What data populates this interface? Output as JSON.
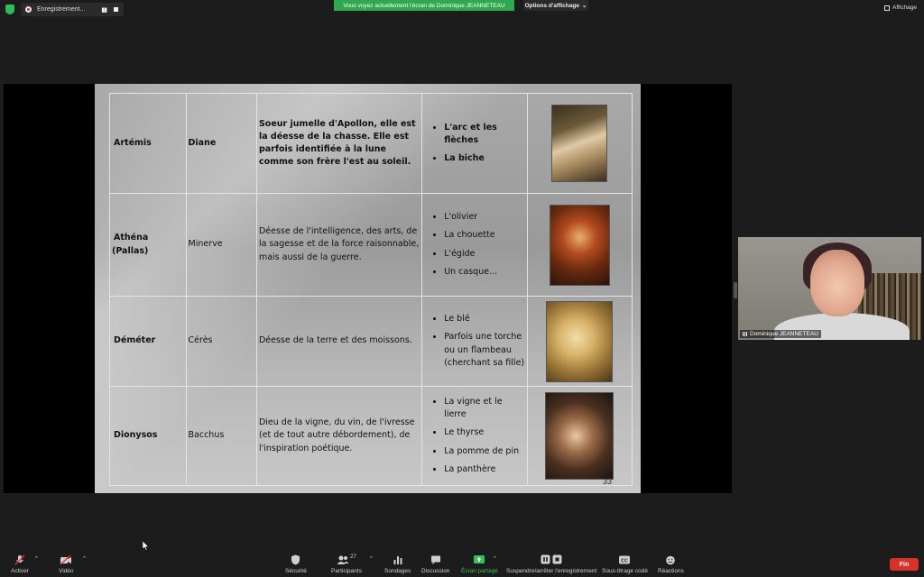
{
  "topbar": {
    "recording_label": "Enregistrement...",
    "share_banner": "Vous voyez actuellement l'écran de Dominique JEANNETEAU",
    "view_options": "Options d'affichage",
    "view_button": "Affichage"
  },
  "slide": {
    "rows": [
      {
        "greek": "Artémis",
        "roman": "Diane",
        "description": "Soeur jumelle d'Apollon, elle est la déesse de la chasse. Elle est parfois identifiée à la lune comme son frère l'est au soleil.",
        "attributes": [
          "L'arc et les flèches",
          "La biche"
        ]
      },
      {
        "greek": "Athéna (Pallas)",
        "roman": "Minerve",
        "description": "Déesse de l'intelligence, des arts, de la sagesse et de la force raisonnable, mais aussi de la guerre.",
        "attributes": [
          "L'olivier",
          "La chouette",
          "L'égide",
          "Un casque..."
        ]
      },
      {
        "greek": "Déméter",
        "roman": "Cérès",
        "description": "Déesse de la terre et des moissons.",
        "attributes": [
          "Le blé",
          "Parfois une torche ou un flambeau (cherchant sa fille)"
        ]
      },
      {
        "greek": "Dionysos",
        "roman": "Bacchus",
        "description": "Dieu de la vigne, du vin, de l'ivresse (et de tout autre débordement), de l'inspiration poétique.",
        "attributes": [
          "La vigne et le lierre",
          "Le thyrse",
          "La pomme de pin",
          "La panthère"
        ]
      }
    ],
    "page_number": "33"
  },
  "participant": {
    "name": "Dominique JEANNETEAU"
  },
  "toolbar": {
    "activate": "Activer",
    "video": "Vidéo",
    "security": "Sécurité",
    "participants": "Participants",
    "participants_count": "27",
    "polls": "Sondages",
    "chat": "Discussion",
    "share": "Écran partagé",
    "recording": "Suspendre/arrêter l'enregistrement",
    "captions": "Sous-titrage codé",
    "reactions": "Réactions",
    "end": "Fin"
  },
  "colors": {
    "share_green": "#2fa84f",
    "end_red": "#d9302c",
    "background": "#1c1c1c"
  }
}
